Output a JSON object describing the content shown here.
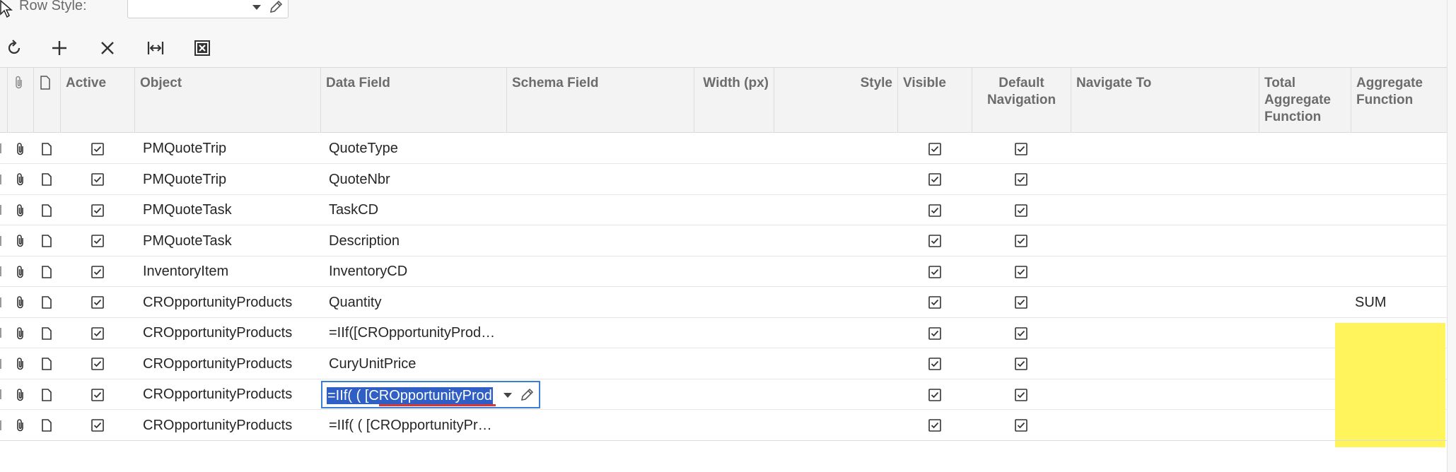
{
  "colors": {
    "accent": "#3c7dd9",
    "selection": "#2f5fc4",
    "highlight": "#fff45c"
  },
  "filter": {
    "row_style_label": "Row Style:",
    "row_style_value": ""
  },
  "toolbar": [
    {
      "name": "refresh-button",
      "icon": "refresh-icon"
    },
    {
      "name": "add-row-button",
      "icon": "plus-icon"
    },
    {
      "name": "delete-row-button",
      "icon": "close-icon"
    },
    {
      "name": "fit-to-screen-button",
      "icon": "fit-width-icon"
    },
    {
      "name": "export-excel-button",
      "icon": "excel-icon"
    }
  ],
  "columns": {
    "active": "Active",
    "object": "Object",
    "data_field": "Data Field",
    "schema_field": "Schema Field",
    "width": "Width (px)",
    "style": "Style",
    "visible": "Visible",
    "default_navigation": "Default Navigation",
    "navigate_to": "Navigate To",
    "total_aggregate_function": "Total Aggregate Function",
    "aggregate_function": "Aggregate Function"
  },
  "rows": [
    {
      "active": true,
      "object": "PMQuoteTrip",
      "data_field": "QuoteType",
      "schema_field": "",
      "width": "",
      "style": "",
      "visible": true,
      "default_navigation": true,
      "navigate_to": "",
      "total_aggregate_function": "",
      "aggregate_function": ""
    },
    {
      "active": true,
      "object": "PMQuoteTrip",
      "data_field": "QuoteNbr",
      "schema_field": "",
      "width": "",
      "style": "",
      "visible": true,
      "default_navigation": true,
      "navigate_to": "",
      "total_aggregate_function": "",
      "aggregate_function": ""
    },
    {
      "active": true,
      "object": "PMQuoteTask",
      "data_field": "TaskCD",
      "schema_field": "",
      "width": "",
      "style": "",
      "visible": true,
      "default_navigation": true,
      "navigate_to": "",
      "total_aggregate_function": "",
      "aggregate_function": ""
    },
    {
      "active": true,
      "object": "PMQuoteTask",
      "data_field": "Description",
      "schema_field": "",
      "width": "",
      "style": "",
      "visible": true,
      "default_navigation": true,
      "navigate_to": "",
      "total_aggregate_function": "",
      "aggregate_function": ""
    },
    {
      "active": true,
      "object": "InventoryItem",
      "data_field": "InventoryCD",
      "schema_field": "",
      "width": "",
      "style": "",
      "visible": true,
      "default_navigation": true,
      "navigate_to": "",
      "total_aggregate_function": "",
      "aggregate_function": ""
    },
    {
      "active": true,
      "object": "CROpportunityProducts",
      "data_field": "Quantity",
      "schema_field": "",
      "width": "",
      "style": "",
      "visible": true,
      "default_navigation": true,
      "navigate_to": "",
      "total_aggregate_function": "",
      "aggregate_function": "SUM"
    },
    {
      "active": true,
      "object": "CROpportunityProducts",
      "data_field": "=IIf([CROpportunityProd…",
      "schema_field": "",
      "width": "",
      "style": "",
      "visible": true,
      "default_navigation": true,
      "navigate_to": "",
      "total_aggregate_function": "",
      "aggregate_function": ""
    },
    {
      "active": true,
      "object": "CROpportunityProducts",
      "data_field": "CuryUnitPrice",
      "schema_field": "",
      "width": "",
      "style": "",
      "visible": true,
      "default_navigation": true,
      "navigate_to": "",
      "total_aggregate_function": "",
      "aggregate_function": ""
    },
    {
      "active": true,
      "object": "CROpportunityProducts",
      "data_field": "=IIf(     ( [CROpportunityProd",
      "schema_field": "",
      "width": "",
      "style": "",
      "visible": true,
      "default_navigation": true,
      "navigate_to": "",
      "total_aggregate_function": "",
      "aggregate_function": "",
      "editing": true
    },
    {
      "active": true,
      "object": "CROpportunityProducts",
      "data_field": "=IIf( ( [CROpportunityPr…",
      "schema_field": "",
      "width": "",
      "style": "",
      "visible": true,
      "default_navigation": true,
      "navigate_to": "",
      "total_aggregate_function": "",
      "aggregate_function": ""
    }
  ]
}
